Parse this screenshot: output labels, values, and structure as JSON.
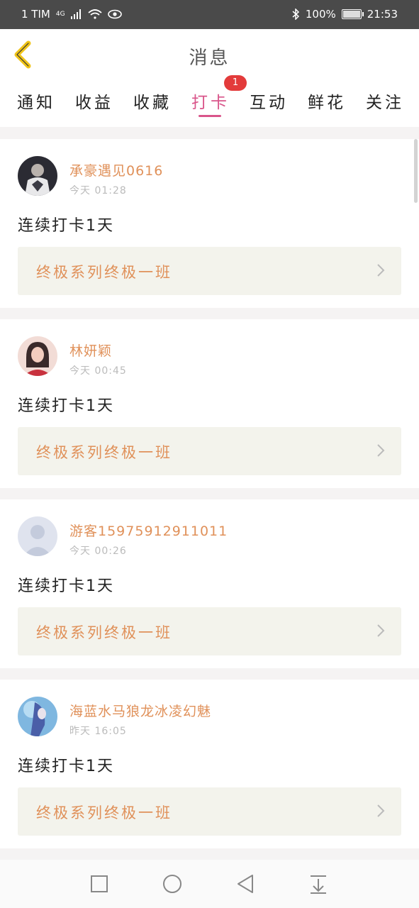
{
  "status_bar": {
    "carrier": "1 TIM",
    "network": "4G",
    "battery": "100%",
    "time": "21:53"
  },
  "header": {
    "title": "消息"
  },
  "tabs": [
    {
      "label": "通知"
    },
    {
      "label": "收益"
    },
    {
      "label": "收藏"
    },
    {
      "label": "打卡",
      "active": true
    },
    {
      "label": "互动"
    },
    {
      "label": "鲜花"
    },
    {
      "label": "关注"
    }
  ],
  "active_tab_badge": "1",
  "cards": [
    {
      "name": "承豪遇见0616",
      "time": "今天 01:28",
      "message": "连续打卡1天",
      "course": "终极系列终极一班"
    },
    {
      "name": "林妍颖",
      "time": "今天 00:45",
      "message": "连续打卡1天",
      "course": "终极系列终极一班"
    },
    {
      "name": "游客15975912911011",
      "time": "今天 00:26",
      "message": "连续打卡1天",
      "course": "终极系列终极一班"
    },
    {
      "name": "海蓝水马狼龙冰凌幻魅",
      "time": "昨天 16:05",
      "message": "连续打卡1天",
      "course": "终极系列终极一班"
    }
  ],
  "colors": {
    "accent": "#d9558a",
    "name": "#e0915a",
    "badge": "#e33b3b",
    "back_arrow": "#f0c419"
  }
}
